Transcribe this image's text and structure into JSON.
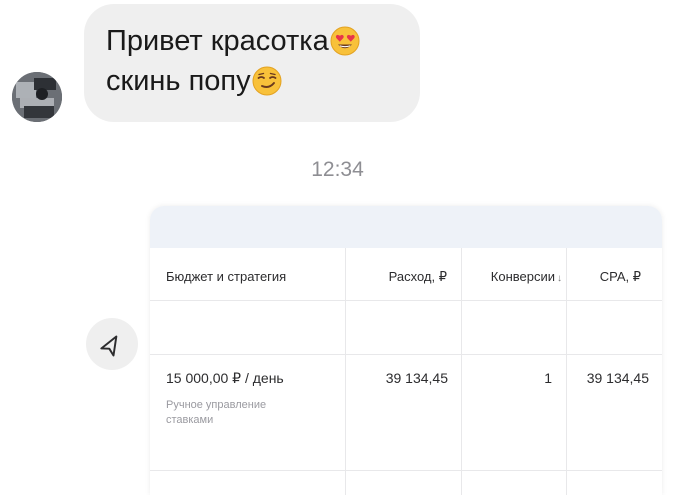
{
  "message": {
    "line1": "Привет красотка",
    "line1_emoji": "heart-eyes-emoji",
    "line2": "скинь попу",
    "line2_emoji": "smirk-emoji"
  },
  "timestamp": "12:34",
  "card": {
    "headers": {
      "budget": "Бюджет и стратегия",
      "spend": "Расход, ₽",
      "conversions": "Конверсии",
      "conversions_sort": "↓",
      "cpa": "CPA, ₽"
    },
    "row": {
      "budget": "15 000,00 ₽ / день",
      "strategy": "Ручное управление ставками",
      "spend": "39 134,45",
      "conversions": "1",
      "cpa": "39 134,45"
    }
  },
  "colors": {
    "bubble": "#efefef",
    "timestamp": "#8e8e93",
    "card_header": "#eef2f8",
    "emoji_face": "#f8c13a"
  }
}
